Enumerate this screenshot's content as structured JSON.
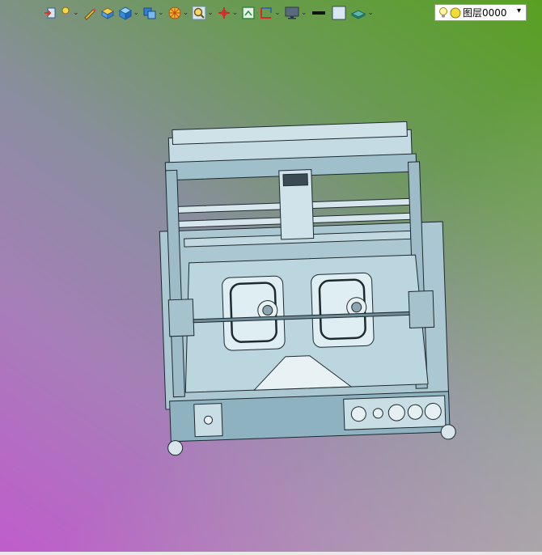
{
  "toolbar": {
    "buttons": [
      {
        "icon": "exit-view-icon",
        "has_dropdown": false
      },
      {
        "icon": "pointer-light-icon",
        "has_dropdown": true
      },
      {
        "icon": "pencil-icon",
        "has_dropdown": false
      },
      {
        "icon": "yellow-box-icon",
        "has_dropdown": false
      },
      {
        "icon": "blue-cube-icon",
        "has_dropdown": true
      },
      {
        "icon": "view-cube-icon",
        "has_dropdown": true
      },
      {
        "icon": "color-wheel-icon",
        "has_dropdown": true
      },
      {
        "icon": "zoom-icon",
        "has_dropdown": true
      },
      {
        "icon": "red-axis-icon",
        "has_dropdown": true
      },
      {
        "icon": "green-frame-icon",
        "has_dropdown": false
      },
      {
        "icon": "red-bracket-icon",
        "has_dropdown": true
      },
      {
        "icon": "monitor-icon",
        "has_dropdown": true
      },
      {
        "icon": "black-line-icon",
        "has_dropdown": false
      },
      {
        "icon": "light-square-icon",
        "has_dropdown": false
      },
      {
        "icon": "layer-plane-icon",
        "has_dropdown": true
      }
    ],
    "dropdown_glyph": "⌄"
  },
  "layer_select": {
    "icons": [
      "lightbulb-icon",
      "yellow-circle-icon"
    ],
    "value": "图层0000",
    "arrow": "▾"
  },
  "colors": {
    "bg_green": "#58a021",
    "bg_magenta": "#c05ccc",
    "model_fill": "#b4d0da",
    "model_stroke": "#1e2a30"
  }
}
